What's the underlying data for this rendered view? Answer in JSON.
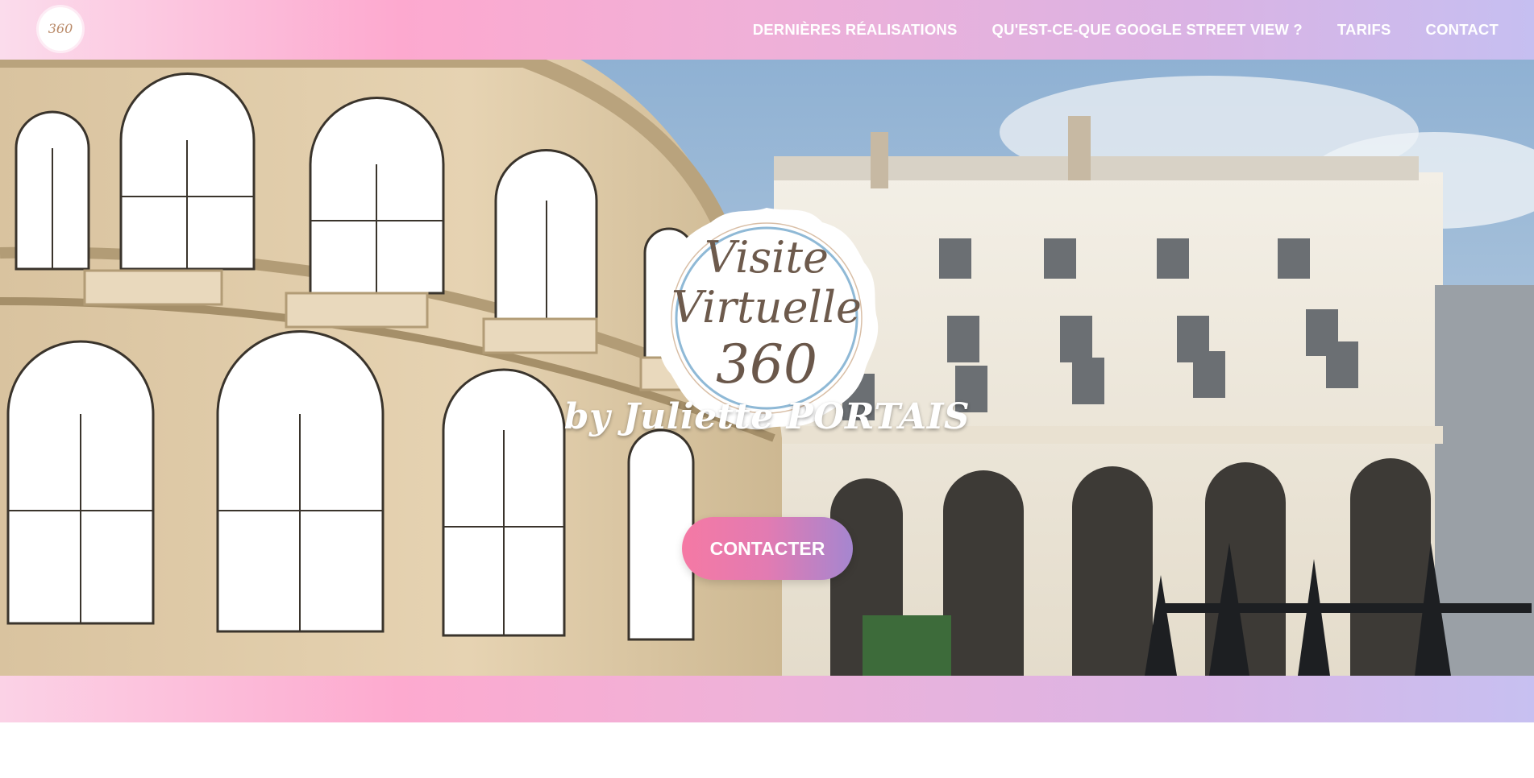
{
  "header": {
    "logo_text": "360",
    "nav": [
      {
        "label": "DERNIÈRES RÉALISATIONS"
      },
      {
        "label": "QU'EST-CE-QUE GOOGLE STREET VIEW ?"
      },
      {
        "label": "TARIFS"
      },
      {
        "label": "CONTACT"
      }
    ]
  },
  "hero": {
    "logo_line1": "Visite",
    "logo_line2": "Virtuelle",
    "logo_line3": "360",
    "byline": "by Juliette PORTAIS",
    "cta_label": "CONTACTER"
  },
  "colors": {
    "accent_pink": "#fda9cf",
    "accent_lavender": "#c6bff1",
    "cta_start": "#f579a4",
    "cta_end": "#a586d0"
  }
}
